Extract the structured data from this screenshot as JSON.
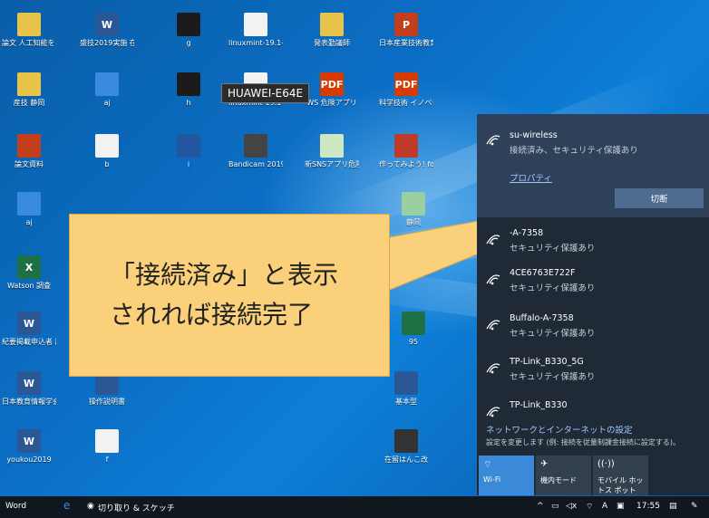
{
  "desktop": {
    "tooltip": "HUAWEI-E64E",
    "icons": [
      {
        "label": "論文 人工知能を 用いた双方向性の...",
        "color": "#e8c34a",
        "glyph": ""
      },
      {
        "label": "盛技2019実施 在 曜",
        "color": "#2b5797",
        "glyph": "W"
      },
      {
        "label": "g",
        "color": "#1b1b1b",
        "glyph": ""
      },
      {
        "label": "linuxmint-19.1-m...",
        "color": "#f2f2f2",
        "glyph": ""
      },
      {
        "label": "発表勤議師",
        "color": "#e8c34a",
        "glyph": ""
      },
      {
        "label": "日本産業技術教育 学会家部室",
        "color": "#c43e1c",
        "glyph": "P"
      },
      {
        "label": "産技 静岡",
        "color": "#e8c34a",
        "glyph": ""
      },
      {
        "label": "aj",
        "color": "#3a8be0",
        "glyph": ""
      },
      {
        "label": "h",
        "color": "#1b1b1b",
        "glyph": ""
      },
      {
        "label": "linuxmint-19.1-ci...",
        "color": "#f2f2f2",
        "glyph": ""
      },
      {
        "label": "WS 危険アプリ",
        "color": "#d83b01",
        "glyph": "PDF"
      },
      {
        "label": "科学技術 イノベー ション政策",
        "color": "#d83b01",
        "glyph": "PDF"
      },
      {
        "label": "論文資料",
        "color": "#c43e1c",
        "glyph": ""
      },
      {
        "label": "b",
        "color": "#f2f2f2",
        "glyph": ""
      },
      {
        "label": "i",
        "color": "#2355a0",
        "glyph": ""
      },
      {
        "label": "Bandicam 2019-09-26...",
        "color": "#444",
        "glyph": ""
      },
      {
        "label": "新SNSアプリ危険性",
        "color": "#cfe8c4",
        "glyph": ""
      },
      {
        "label": "作ってみよう! forSchool",
        "color": "#c0392b",
        "glyph": ""
      },
      {
        "label": "aj",
        "color": "#3a8be0",
        "glyph": ""
      },
      {
        "label": "Watson 調査",
        "color": "#1e7145",
        "glyph": "X"
      },
      {
        "label": "紀要掲載申込者 層 (山村)",
        "color": "#2b5797",
        "glyph": "W"
      },
      {
        "label": "日本教育情報学会 誌 在曜",
        "color": "#2b5797",
        "glyph": "W"
      },
      {
        "label": "操作説明書",
        "color": "#2b5797",
        "glyph": ""
      },
      {
        "label": "基本型",
        "color": "#2b5797",
        "glyph": ""
      },
      {
        "label": "youkou2019",
        "color": "#2b5797",
        "glyph": "W"
      },
      {
        "label": "f",
        "color": "#f2f2f2",
        "glyph": ""
      },
      {
        "label": "在留はんこ改",
        "color": "#333",
        "glyph": ""
      },
      {
        "label": "静岡",
        "color": "#9ad0a0",
        "glyph": ""
      },
      {
        "label": "95",
        "color": "#1e7145",
        "glyph": ""
      }
    ]
  },
  "flyout": {
    "active": {
      "ssid": "su-wireless",
      "status": "接続済み、セキュリティ保護あり",
      "properties": "プロパティ",
      "disconnect": "切断"
    },
    "networks": [
      {
        "ssid": "-A-7358",
        "status": "セキュリティ保護あり"
      },
      {
        "ssid": "4CE6763E722F",
        "status": "セキュリティ保護あり"
      },
      {
        "ssid": "Buffalo-A-7358",
        "status": "セキュリティ保護あり"
      },
      {
        "ssid": "TP-Link_B330_5G",
        "status": "セキュリティ保護あり"
      },
      {
        "ssid": "TP-Link_B330",
        "status": ""
      }
    ],
    "settings_title": "ネットワークとインターネットの設定",
    "settings_sub": "設定を変更します (例: 接続を従量制課金接続に設定する)。",
    "quick": [
      {
        "label": "Wi-Fi",
        "icon": "wifi-icon",
        "active": true
      },
      {
        "label": "機内モード",
        "icon": "airplane-icon",
        "active": false
      },
      {
        "label": "モバイル ホットス ポット",
        "icon": "hotspot-icon",
        "active": false
      }
    ],
    "colors": {
      "accent": "#3a8ad8",
      "panel": "#1f2a36"
    }
  },
  "callout": {
    "line1": "「接続済み」と表示",
    "line2": "されれば接続完了",
    "color": "#fbd07a"
  },
  "taskbar": {
    "app1": "Word",
    "app2": "切り取り & スケッチ",
    "time": "17:55"
  }
}
